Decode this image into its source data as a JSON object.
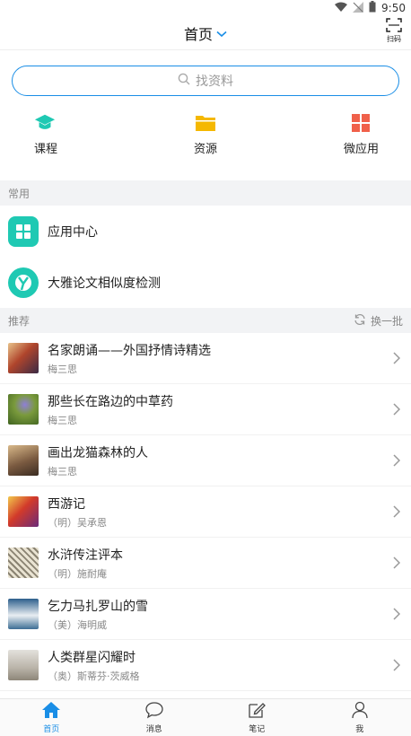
{
  "status_bar": {
    "time": "9:50"
  },
  "header": {
    "title": "首页",
    "scan_label": "扫码"
  },
  "search": {
    "placeholder": "找资料"
  },
  "quick_actions": [
    {
      "label": "课程",
      "icon": "graduation-cap-icon",
      "color": "#1fc9b3"
    },
    {
      "label": "资源",
      "icon": "folder-icon",
      "color": "#f5b800"
    },
    {
      "label": "微应用",
      "icon": "grid-apps-icon",
      "color": "#f0604a"
    }
  ],
  "common": {
    "title": "常用",
    "items": [
      {
        "label": "应用中心",
        "icon": "app-center-icon"
      },
      {
        "label": "大雅论文相似度检测",
        "icon": "daya-check-icon"
      }
    ]
  },
  "recommend": {
    "title": "推荐",
    "refresh_label": "换一批",
    "items": [
      {
        "title": "名家朗诵——外国抒情诗精选",
        "author": "梅三思"
      },
      {
        "title": "那些长在路边的中草药",
        "author": "梅三思"
      },
      {
        "title": "画出龙猫森林的人",
        "author": "梅三思"
      },
      {
        "title": "西游记",
        "author": "（明）吴承恩"
      },
      {
        "title": "水浒传注评本",
        "author": "（明）施耐庵"
      },
      {
        "title": "乞力马扎罗山的雪",
        "author": "（美）海明威"
      },
      {
        "title": "人类群星闪耀时",
        "author": "（奥）斯蒂芬·茨威格"
      }
    ]
  },
  "tabs": [
    {
      "label": "首页",
      "icon": "home-icon",
      "active": true
    },
    {
      "label": "消息",
      "icon": "message-icon",
      "active": false
    },
    {
      "label": "笔记",
      "icon": "note-icon",
      "active": false
    },
    {
      "label": "我",
      "icon": "profile-icon",
      "active": false
    }
  ],
  "colors": {
    "accent": "#1a8ee6",
    "teal": "#1fc9b3",
    "section_bg": "#f2f3f5"
  }
}
